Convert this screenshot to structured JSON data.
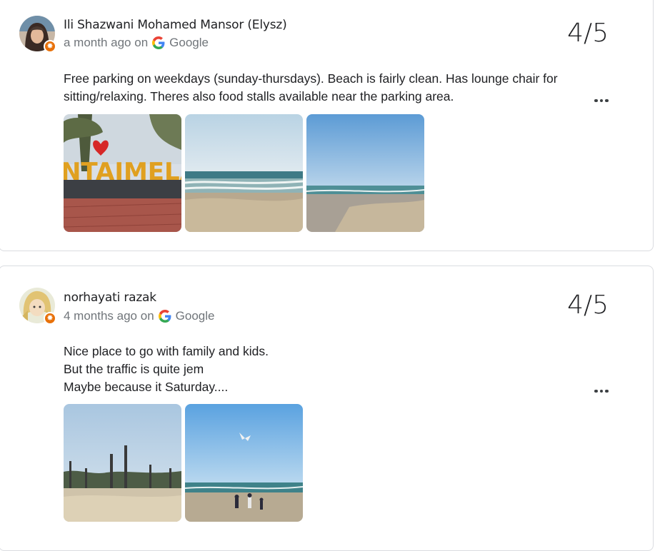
{
  "reviews": [
    {
      "author": "Ili Shazwani Mohamed Mansor (Elysz)",
      "time": "a month ago on",
      "source": "Google",
      "rating": "4/5",
      "lines": [
        "Free parking on weekdays (sunday-thursdays). Beach is fairly clean. Has lounge chair for",
        "sitting/relaxing. Theres also food stalls available near the parking area."
      ],
      "photos": [
        "melaka-sign-photo",
        "beach-waves-photo",
        "beach-shore-photo"
      ],
      "photo_sign_text": "NTAIMELAW"
    },
    {
      "author": "norhayati razak",
      "time": "4 months ago on",
      "source": "Google",
      "rating": "4/5",
      "lines": [
        "Nice place to go with family and kids.",
        "But the traffic is quite jem",
        "Maybe because it Saturday...."
      ],
      "photos": [
        "beach-poles-photo",
        "beach-kite-photo"
      ]
    }
  ],
  "colors": {
    "local_guide_badge": "#e8710a",
    "meta_text": "#70757a",
    "border": "#dadce0"
  },
  "icons": {
    "google": "google-g-icon",
    "more": "more-options-icon",
    "badge": "local-guide-badge-icon"
  }
}
